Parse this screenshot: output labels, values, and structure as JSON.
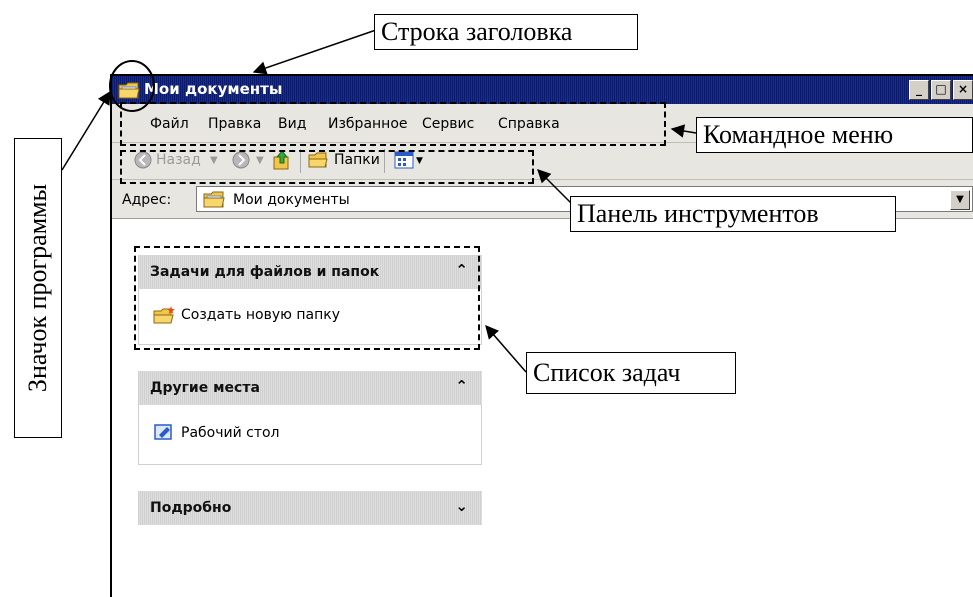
{
  "annotations": {
    "title_bar": "Строка заголовка",
    "command_menu": "Командное меню",
    "toolbar": "Панель инструментов",
    "task_list": "Список задач",
    "program_icon": "Значок программы"
  },
  "window": {
    "title": "Мои документы",
    "buttons": [
      "_",
      "□",
      "×"
    ]
  },
  "menu": {
    "items": [
      "Файл",
      "Правка",
      "Вид",
      "Избранное",
      "Сервис",
      "Справка"
    ]
  },
  "toolbar": {
    "back": "Назад",
    "folders": "Папки"
  },
  "address": {
    "label": "Адрес:",
    "value": "Мои документы"
  },
  "panels": {
    "tasks": {
      "title": "Задачи для файлов и папок",
      "chevron": "⌃",
      "item": "Создать новую папку"
    },
    "other": {
      "title": "Другие места",
      "chevron": "⌃",
      "item": "Рабочий стол"
    },
    "details": {
      "title": "Подробно",
      "chevron": "⌄"
    }
  },
  "colors": {
    "titlebar": "#0a1a6e",
    "menubar": "#e8e6e0",
    "panel_header": "#d9d9d9"
  }
}
